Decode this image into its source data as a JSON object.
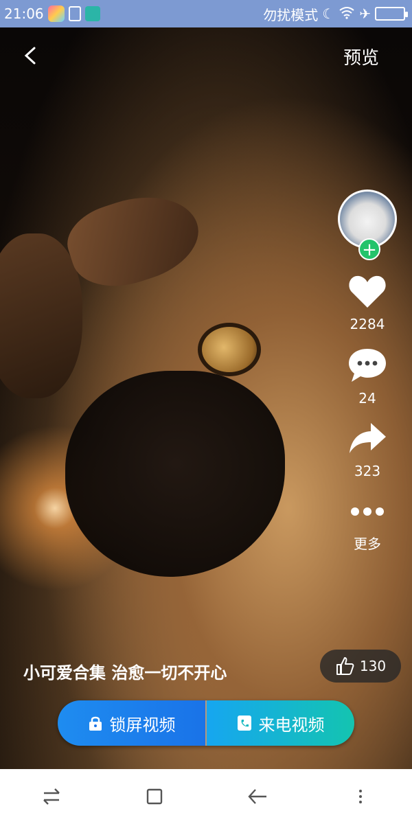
{
  "status_bar": {
    "time": "21:06",
    "dnd_text": "勿扰模式",
    "icons": [
      "app-icon",
      "brush-icon",
      "usb-icon",
      "moon-icon",
      "wifi-icon",
      "airplane-icon",
      "battery-icon"
    ]
  },
  "topbar": {
    "back_icon": "back-arrow-icon",
    "preview_label": "预览"
  },
  "rail": {
    "like_count": "2284",
    "comment_count": "24",
    "share_count": "323",
    "more_label": "更多"
  },
  "caption": "小可爱合集 治愈一切不开心",
  "like_pill": {
    "count": "130"
  },
  "actions": {
    "lock_screen_label": "锁屏视频",
    "call_label": "来电视频"
  },
  "colors": {
    "statusbar": "#7d9ad2",
    "follow_green": "#23c36b",
    "lock_blue": "#1e8cf0",
    "call_teal": "#14c4b0"
  }
}
